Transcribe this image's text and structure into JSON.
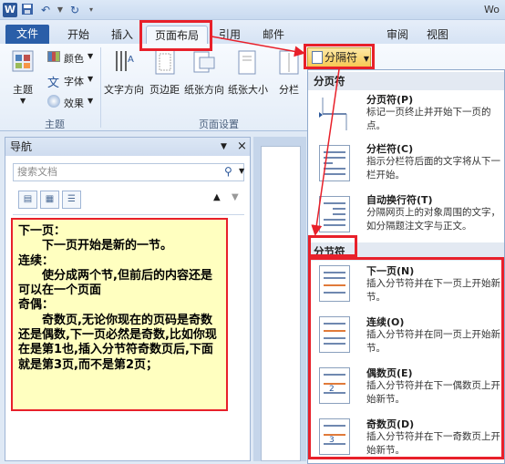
{
  "app": {
    "title_partial": "Wo"
  },
  "quick_access": {
    "word_icon": "W",
    "save_icon": "save-icon",
    "undo_icon": "undo-icon",
    "redo_icon": "redo-icon",
    "customize_icon": "customize-icon"
  },
  "tabs": {
    "file": "文件",
    "items": [
      "开始",
      "插入",
      "页面布局",
      "引用",
      "邮件",
      "审阅",
      "视图"
    ]
  },
  "ribbon": {
    "theme_group": {
      "themes_label": "主题",
      "colors_label": "颜色",
      "fonts_label": "字体",
      "effects_label": "效果",
      "group_label": "主题"
    },
    "page_setup_group": {
      "text_direction": "文字方向",
      "margins": "页边距",
      "orientation": "纸张方向",
      "size": "纸张大小",
      "columns": "分栏",
      "group_label": "页面设置"
    },
    "breaks_button": "分隔符"
  },
  "nav_pane": {
    "title": "导航",
    "search_placeholder": "搜索文档",
    "close": "×",
    "menu": "▼"
  },
  "note": {
    "lines": [
      "下一页：",
      "　　下一页开始是新的一节。",
      "连续：",
      "　　使分成两个节,但前后的内容还是可以在一个页面",
      "奇偶：",
      "　　奇数页,无论你现在的页码是奇数还是偶数,下一页必然是奇数,比如你现在是第1也,插入分节符奇数页后,下面就是第3页,而不是第2页；"
    ]
  },
  "dropdown": {
    "page_breaks_header": "分页符",
    "section_breaks_header": "分节符",
    "page_breaks": [
      {
        "title": "分页符(P)",
        "desc": "标记一页终止并开始下一页的点。"
      },
      {
        "title": "分栏符(C)",
        "desc": "指示分栏符后面的文字将从下一栏开始。"
      },
      {
        "title": "自动换行符(T)",
        "desc": "分隔网页上的对象周围的文字，如分隔题注文字与正文。"
      }
    ],
    "section_breaks": [
      {
        "title": "下一页(N)",
        "desc": "插入分节符并在下一页上开始新节。"
      },
      {
        "title": "连续(O)",
        "desc": "插入分节符并在同一页上开始新节。"
      },
      {
        "title": "偶数页(E)",
        "desc": "插入分节符并在下一偶数页上开始新节。"
      },
      {
        "title": "奇数页(D)",
        "desc": "插入分节符并在下一奇数页上开始新节。"
      }
    ]
  },
  "colors": {
    "highlight_red": "#e8202a",
    "note_yellow": "#ffffc0",
    "file_tab_blue": "#2a5ea8"
  }
}
